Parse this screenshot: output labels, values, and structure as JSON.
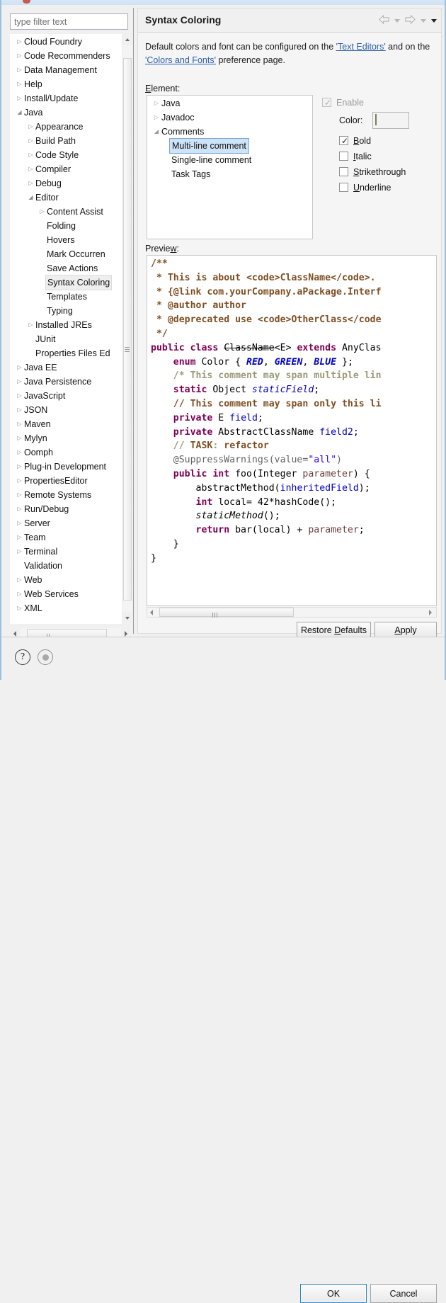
{
  "window": {
    "title_visible": ""
  },
  "filter": {
    "placeholder": "type filter text",
    "value": ""
  },
  "tree": {
    "items": [
      {
        "label": "Cloud Foundry",
        "depth": 0,
        "twisty": "collapsed",
        "selected": false
      },
      {
        "label": "Code Recommenders",
        "depth": 0,
        "twisty": "collapsed",
        "selected": false
      },
      {
        "label": "Data Management",
        "depth": 0,
        "twisty": "collapsed",
        "selected": false
      },
      {
        "label": "Help",
        "depth": 0,
        "twisty": "collapsed",
        "selected": false
      },
      {
        "label": "Install/Update",
        "depth": 0,
        "twisty": "collapsed",
        "selected": false
      },
      {
        "label": "Java",
        "depth": 0,
        "twisty": "expanded",
        "selected": false
      },
      {
        "label": "Appearance",
        "depth": 1,
        "twisty": "collapsed",
        "selected": false
      },
      {
        "label": "Build Path",
        "depth": 1,
        "twisty": "collapsed",
        "selected": false
      },
      {
        "label": "Code Style",
        "depth": 1,
        "twisty": "collapsed",
        "selected": false
      },
      {
        "label": "Compiler",
        "depth": 1,
        "twisty": "collapsed",
        "selected": false
      },
      {
        "label": "Debug",
        "depth": 1,
        "twisty": "collapsed",
        "selected": false
      },
      {
        "label": "Editor",
        "depth": 1,
        "twisty": "expanded",
        "selected": false
      },
      {
        "label": "Content Assist",
        "depth": 2,
        "twisty": "collapsed",
        "selected": false
      },
      {
        "label": "Folding",
        "depth": 2,
        "twisty": "none",
        "selected": false
      },
      {
        "label": "Hovers",
        "depth": 2,
        "twisty": "none",
        "selected": false
      },
      {
        "label": "Mark Occurren",
        "depth": 2,
        "twisty": "none",
        "selected": false
      },
      {
        "label": "Save Actions",
        "depth": 2,
        "twisty": "none",
        "selected": false
      },
      {
        "label": "Syntax Coloring",
        "depth": 2,
        "twisty": "none",
        "selected": true
      },
      {
        "label": "Templates",
        "depth": 2,
        "twisty": "none",
        "selected": false
      },
      {
        "label": "Typing",
        "depth": 2,
        "twisty": "none",
        "selected": false
      },
      {
        "label": "Installed JREs",
        "depth": 1,
        "twisty": "collapsed",
        "selected": false
      },
      {
        "label": "JUnit",
        "depth": 1,
        "twisty": "none",
        "selected": false
      },
      {
        "label": "Properties Files Ed",
        "depth": 1,
        "twisty": "none",
        "selected": false
      },
      {
        "label": "Java EE",
        "depth": 0,
        "twisty": "collapsed",
        "selected": false
      },
      {
        "label": "Java Persistence",
        "depth": 0,
        "twisty": "collapsed",
        "selected": false
      },
      {
        "label": "JavaScript",
        "depth": 0,
        "twisty": "collapsed",
        "selected": false
      },
      {
        "label": "JSON",
        "depth": 0,
        "twisty": "collapsed",
        "selected": false
      },
      {
        "label": "Maven",
        "depth": 0,
        "twisty": "collapsed",
        "selected": false
      },
      {
        "label": "Mylyn",
        "depth": 0,
        "twisty": "collapsed",
        "selected": false
      },
      {
        "label": "Oomph",
        "depth": 0,
        "twisty": "collapsed",
        "selected": false
      },
      {
        "label": "Plug-in Development",
        "depth": 0,
        "twisty": "collapsed",
        "selected": false
      },
      {
        "label": "PropertiesEditor",
        "depth": 0,
        "twisty": "collapsed",
        "selected": false
      },
      {
        "label": "Remote Systems",
        "depth": 0,
        "twisty": "collapsed",
        "selected": false
      },
      {
        "label": "Run/Debug",
        "depth": 0,
        "twisty": "collapsed",
        "selected": false
      },
      {
        "label": "Server",
        "depth": 0,
        "twisty": "collapsed",
        "selected": false
      },
      {
        "label": "Team",
        "depth": 0,
        "twisty": "collapsed",
        "selected": false
      },
      {
        "label": "Terminal",
        "depth": 0,
        "twisty": "collapsed",
        "selected": false
      },
      {
        "label": "Validation",
        "depth": 0,
        "twisty": "none",
        "selected": false
      },
      {
        "label": "Web",
        "depth": 0,
        "twisty": "collapsed",
        "selected": false
      },
      {
        "label": "Web Services",
        "depth": 0,
        "twisty": "collapsed",
        "selected": false
      },
      {
        "label": "XML",
        "depth": 0,
        "twisty": "collapsed",
        "selected": false
      }
    ]
  },
  "pane": {
    "title": "Syntax Coloring",
    "description_prefix": "Default colors and font can be configured on the ",
    "link1": "'Text Editors'",
    "description_mid": " and on the ",
    "link2": "'Colors and Fonts'",
    "description_suffix": " preference page.",
    "element_label": "Element:",
    "preview_label": "Preview:"
  },
  "element_tree": {
    "items": [
      {
        "label": "Java",
        "depth": 0,
        "twisty": "collapsed",
        "selected": false
      },
      {
        "label": "Javadoc",
        "depth": 0,
        "twisty": "collapsed",
        "selected": false
      },
      {
        "label": "Comments",
        "depth": 0,
        "twisty": "expanded",
        "selected": false
      },
      {
        "label": "Multi-line comment",
        "depth": 1,
        "twisty": "none",
        "selected": true
      },
      {
        "label": "Single-line comment",
        "depth": 1,
        "twisty": "none",
        "selected": false
      },
      {
        "label": "Task Tags",
        "depth": 1,
        "twisty": "none",
        "selected": false
      }
    ]
  },
  "options": {
    "enable": {
      "label": "Enable",
      "checked": true,
      "disabled": true,
      "mnemonic": "b"
    },
    "color": {
      "label": "Color:",
      "value": "#80803f"
    },
    "styles": [
      {
        "label": "Bold",
        "checked": true
      },
      {
        "label": "Italic",
        "checked": false
      },
      {
        "label": "Strikethrough",
        "checked": false
      },
      {
        "label": "Underline",
        "checked": false
      }
    ]
  },
  "preview_code": {
    "lines": [
      [
        {
          "t": "/**",
          "c": "jdoc"
        }
      ],
      [
        {
          "t": " * This is about <code>ClassName</code>.",
          "c": "jdoc"
        }
      ],
      [
        {
          "t": " * {@link com.yourCompany.aPackage.Interf",
          "c": "jdoc"
        }
      ],
      [
        {
          "t": " * @author author",
          "c": "jdoc"
        }
      ],
      [
        {
          "t": " * @deprecated use <code>OtherClass</code",
          "c": "jdoc"
        }
      ],
      [
        {
          "t": " */",
          "c": "jdoc"
        }
      ],
      [
        {
          "t": "public class ",
          "c": "kw"
        },
        {
          "t": "ClassName",
          "c": "deprec"
        },
        {
          "t": "<E> ",
          "c": ""
        },
        {
          "t": "extends ",
          "c": "kw"
        },
        {
          "t": "AnyClas",
          "c": ""
        }
      ],
      [
        {
          "t": "    ",
          "c": ""
        },
        {
          "t": "enum ",
          "c": "kw"
        },
        {
          "t": "Color { ",
          "c": ""
        },
        {
          "t": "RED",
          "c": "enumc"
        },
        {
          "t": ", ",
          "c": ""
        },
        {
          "t": "GREEN",
          "c": "enumc"
        },
        {
          "t": ", ",
          "c": ""
        },
        {
          "t": "BLUE",
          "c": "enumc"
        },
        {
          "t": " };",
          "c": ""
        }
      ],
      [
        {
          "t": "    ",
          "c": ""
        },
        {
          "t": "/* This comment may span multiple lin",
          "c": "mlc"
        }
      ],
      [
        {
          "t": "    ",
          "c": ""
        },
        {
          "t": "static ",
          "c": "kw"
        },
        {
          "t": "Object ",
          "c": ""
        },
        {
          "t": "staticField",
          "c": "sfield"
        },
        {
          "t": ";",
          "c": ""
        }
      ],
      [
        {
          "t": "    ",
          "c": ""
        },
        {
          "t": "// This comment may span only this li",
          "c": "slc"
        }
      ],
      [
        {
          "t": "    ",
          "c": ""
        },
        {
          "t": "private ",
          "c": "kw"
        },
        {
          "t": "E ",
          "c": ""
        },
        {
          "t": "field",
          "c": "field"
        },
        {
          "t": ";",
          "c": ""
        }
      ],
      [
        {
          "t": "    ",
          "c": ""
        },
        {
          "t": "private ",
          "c": "kw"
        },
        {
          "t": "AbstractClassName ",
          "c": ""
        },
        {
          "t": "field2",
          "c": "field"
        },
        {
          "t": ";",
          "c": ""
        }
      ],
      [
        {
          "t": "    ",
          "c": ""
        },
        {
          "t": "// ",
          "c": "task"
        },
        {
          "t": "TASK",
          "c": "taskw"
        },
        {
          "t": ": ",
          "c": "task"
        },
        {
          "t": "refactor",
          "c": "taskw"
        }
      ],
      [
        {
          "t": "    ",
          "c": ""
        },
        {
          "t": "@SuppressWarnings(value=",
          "c": "anno"
        },
        {
          "t": "\"all\"",
          "c": "str"
        },
        {
          "t": ")",
          "c": "anno"
        }
      ],
      [
        {
          "t": "    ",
          "c": ""
        },
        {
          "t": "public int ",
          "c": "kw"
        },
        {
          "t": "foo(Integer ",
          "c": ""
        },
        {
          "t": "parameter",
          "c": "pmeth"
        },
        {
          "t": ") {",
          "c": ""
        }
      ],
      [
        {
          "t": "        abstractMethod(",
          "c": ""
        },
        {
          "t": "inheritedField",
          "c": "field"
        },
        {
          "t": ");",
          "c": ""
        }
      ],
      [
        {
          "t": "        ",
          "c": ""
        },
        {
          "t": "int ",
          "c": "kw"
        },
        {
          "t": "local= 42*hashCode();",
          "c": ""
        }
      ],
      [
        {
          "t": "        ",
          "c": ""
        },
        {
          "t": "staticMethod",
          "c": "smeth"
        },
        {
          "t": "();",
          "c": ""
        }
      ],
      [
        {
          "t": "        ",
          "c": ""
        },
        {
          "t": "return ",
          "c": "kw"
        },
        {
          "t": "bar(local) + ",
          "c": ""
        },
        {
          "t": "parameter",
          "c": "pmeth"
        },
        {
          "t": ";",
          "c": ""
        }
      ],
      [
        {
          "t": "    }",
          "c": ""
        }
      ],
      [
        {
          "t": "}",
          "c": ""
        }
      ]
    ]
  },
  "buttons": {
    "restore_defaults": "Restore Defaults",
    "apply": "Apply",
    "ok": "OK",
    "cancel": "Cancel"
  },
  "footer_icons": {
    "help": "?",
    "record": "record-dot"
  },
  "nav": {
    "back": "back-arrow",
    "back_menu": "chevron-down",
    "forward": "forward-arrow",
    "forward_menu": "chevron-down",
    "view_menu": "chevron-down"
  }
}
